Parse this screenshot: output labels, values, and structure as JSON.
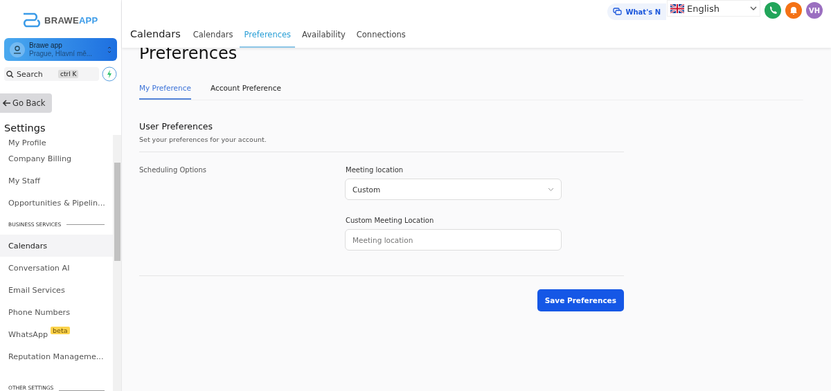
{
  "brand": {
    "name_part_1": "BRAWE",
    "name_part_2": "APP"
  },
  "account": {
    "name": "Brawe app",
    "location": "Prague, Hlavní mě..."
  },
  "search": {
    "placeholder": "Search",
    "shortcut": "ctrl K"
  },
  "back_button": "Go Back",
  "sidebar": {
    "title": "Settings",
    "items": [
      {
        "kind": "item",
        "label": "My Profile",
        "selected": false
      },
      {
        "kind": "item",
        "label": "Company Billing",
        "selected": false
      },
      {
        "kind": "item",
        "label": "My Staff",
        "selected": false
      },
      {
        "kind": "item",
        "label": "Opportunities & Pipelin...",
        "selected": false
      },
      {
        "kind": "section",
        "label": "BUSINESS SERVICES"
      },
      {
        "kind": "item",
        "label": "Calendars",
        "selected": true
      },
      {
        "kind": "item",
        "label": "Conversation AI",
        "selected": false
      },
      {
        "kind": "item",
        "label": "Email Services",
        "selected": false
      },
      {
        "kind": "item",
        "label": "Phone Numbers",
        "selected": false
      },
      {
        "kind": "item",
        "label": "WhatsApp",
        "badge": "beta",
        "selected": false
      },
      {
        "kind": "item",
        "label": "Reputation Manageme...",
        "selected": false
      },
      {
        "kind": "section",
        "label": "OTHER SETTINGS"
      }
    ]
  },
  "header": {
    "title": "Calendars",
    "tabs": [
      {
        "label": "Calendars",
        "selected": false
      },
      {
        "label": "Preferences",
        "selected": true
      },
      {
        "label": "Availability",
        "selected": false
      },
      {
        "label": "Connections",
        "selected": false
      }
    ],
    "whats_new": "What's N",
    "language": "English",
    "avatar": "VH"
  },
  "page": {
    "title": "Preferences",
    "tabs": [
      {
        "label": "My Preference",
        "selected": true
      },
      {
        "label": "Account Preference",
        "selected": false
      }
    ],
    "section_title": "User Preferences",
    "section_subtitle": "Set your preferences for your account.",
    "group_label": "Scheduling Options",
    "fields": [
      {
        "kind": "select",
        "label": "Meeting location",
        "value": "Custom"
      },
      {
        "kind": "text",
        "label": "Custom Meeting Location",
        "placeholder": "Meeting location"
      }
    ],
    "save_button": "Save Preferences"
  }
}
